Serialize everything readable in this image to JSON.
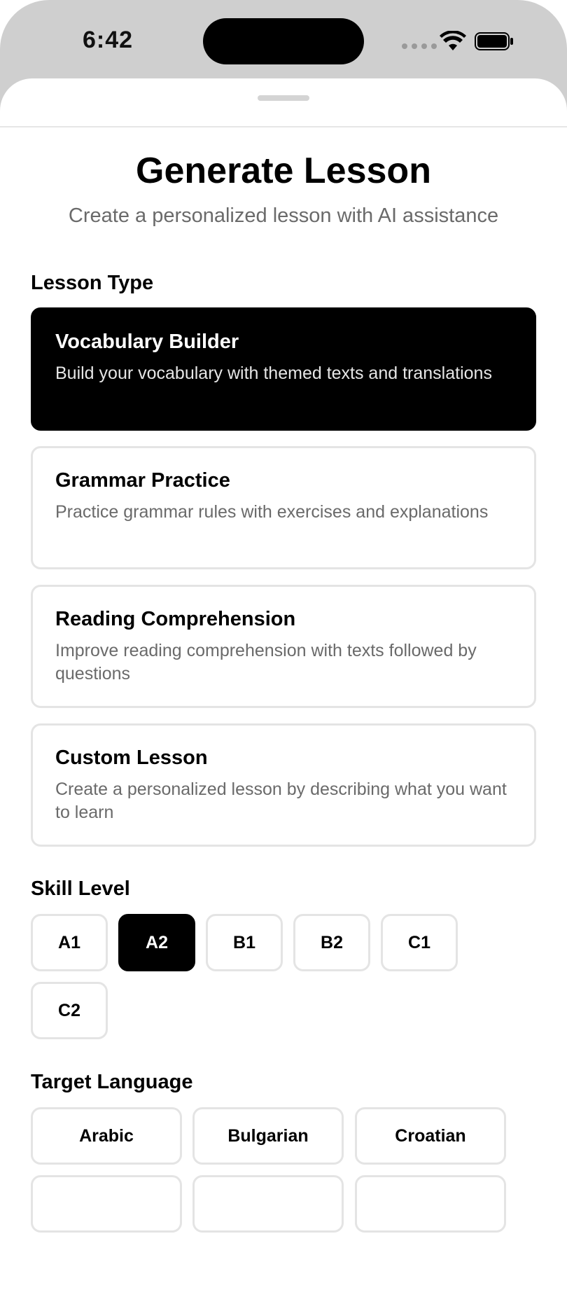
{
  "status_bar": {
    "time": "6:42"
  },
  "header": {
    "title": "Generate Lesson",
    "subtitle": "Create a personalized lesson with AI assistance"
  },
  "lesson_type": {
    "label": "Lesson Type",
    "options": [
      {
        "title": "Vocabulary Builder",
        "description": "Build your vocabulary with themed texts and translations",
        "selected": true
      },
      {
        "title": "Grammar Practice",
        "description": "Practice grammar rules with exercises and explanations",
        "selected": false
      },
      {
        "title": "Reading Comprehension",
        "description": "Improve reading comprehension with texts followed by questions",
        "selected": false
      },
      {
        "title": "Custom Lesson",
        "description": "Create a personalized lesson by describing what you want to learn",
        "selected": false
      }
    ]
  },
  "skill_level": {
    "label": "Skill Level",
    "options": [
      "A1",
      "A2",
      "B1",
      "B2",
      "C1",
      "C2"
    ],
    "selected": "A2"
  },
  "target_language": {
    "label": "Target Language",
    "options": [
      "Arabic",
      "Bulgarian",
      "Croatian"
    ]
  },
  "colors": {
    "accent": "#000000",
    "border": "#e4e4e4",
    "muted_text": "#6a6a6a",
    "device_frame": "#cfcfcf"
  }
}
